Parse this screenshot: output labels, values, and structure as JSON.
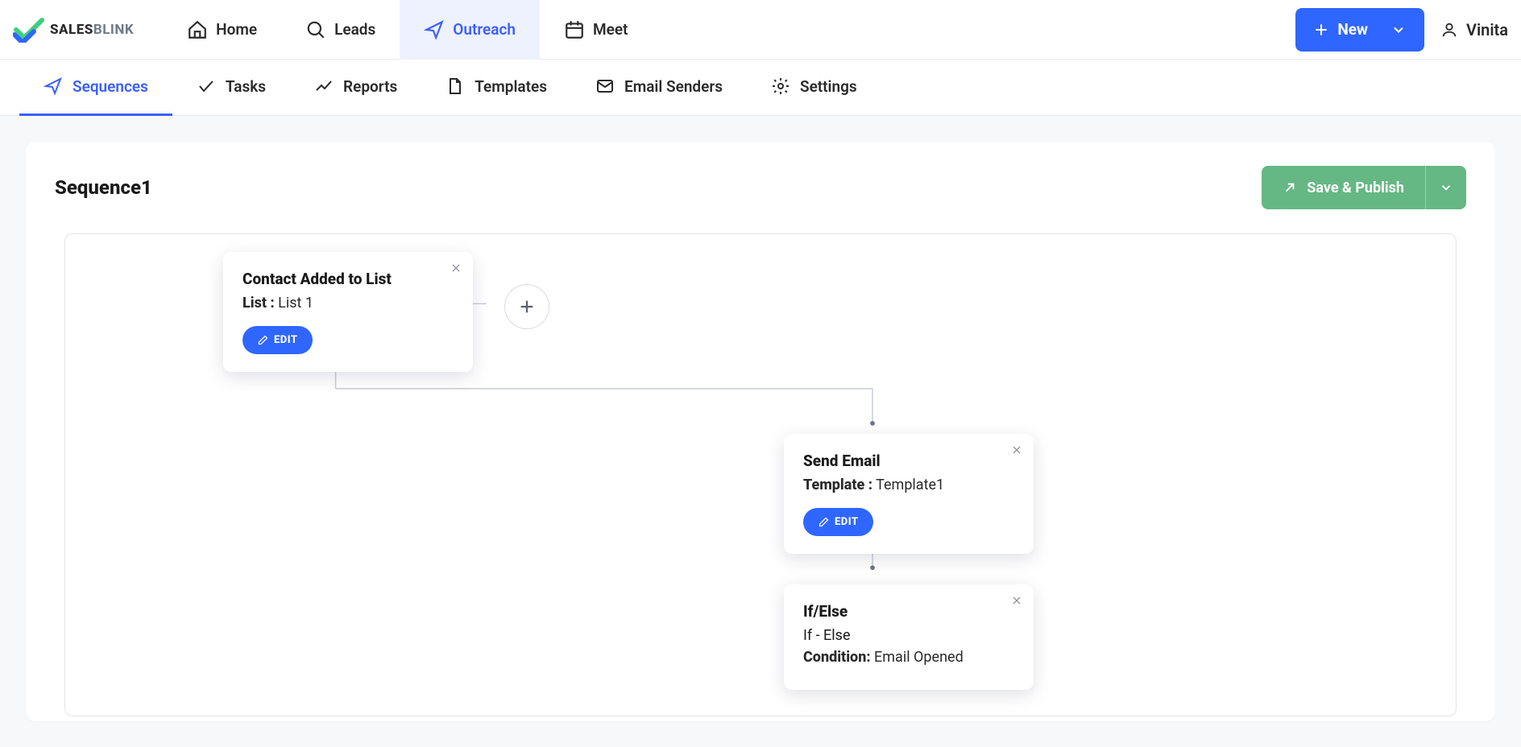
{
  "brand": {
    "name_primary": "SALES",
    "name_secondary": "BLINK"
  },
  "topnav": {
    "items": [
      {
        "label": "Home"
      },
      {
        "label": "Leads"
      },
      {
        "label": "Outreach"
      },
      {
        "label": "Meet"
      }
    ],
    "new_label": "New",
    "user_name": "Vinita"
  },
  "subnav": {
    "items": [
      {
        "label": "Sequences"
      },
      {
        "label": "Tasks"
      },
      {
        "label": "Reports"
      },
      {
        "label": "Templates"
      },
      {
        "label": "Email Senders"
      },
      {
        "label": "Settings"
      }
    ]
  },
  "sequence": {
    "title": "Sequence1",
    "publish_label": "Save & Publish",
    "edit_label": "EDIT",
    "nodes": {
      "trigger": {
        "title": "Contact Added to List",
        "sub_label": "List :",
        "sub_value": " List 1"
      },
      "send_email": {
        "title": "Send Email",
        "sub_label": "Template :",
        "sub_value": " Template1"
      },
      "ifelse": {
        "title": "If/Else",
        "line1": "If - Else",
        "cond_label": "Condition:",
        "cond_value": " Email Opened"
      }
    }
  }
}
